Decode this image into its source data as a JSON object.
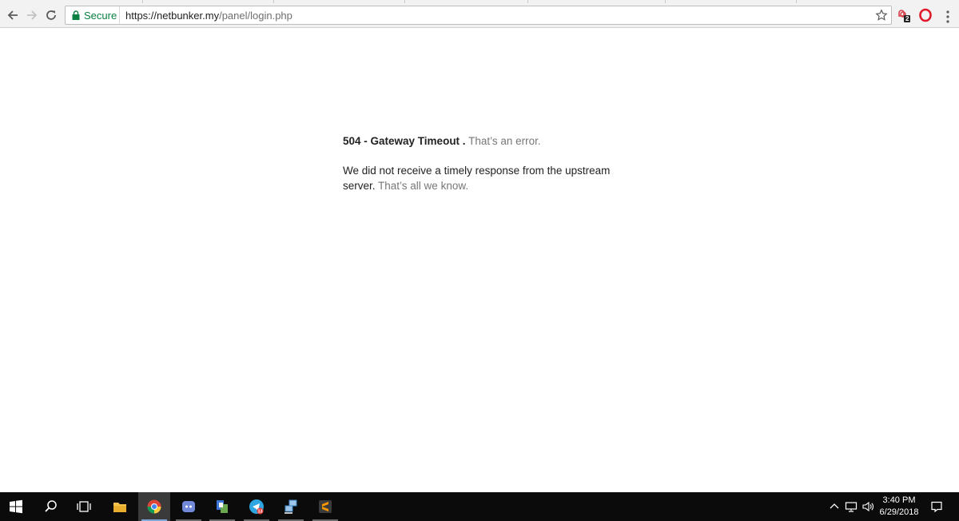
{
  "browser": {
    "omnibox": {
      "secure_label": "Secure",
      "url_scheme_host": "https://netbunker.my",
      "url_path": "/panel/login.php"
    },
    "toolbar_icons": [
      "back-icon",
      "forward-icon",
      "reload-icon",
      "lock-icon",
      "star-icon",
      "extension-icon",
      "opera-icon",
      "menu-icon"
    ],
    "extension_badge": "2",
    "colors": {
      "secure_green": "#0b8043",
      "toolbar_bg": "#f2f2f2",
      "opera_red": "#e0192b"
    }
  },
  "page": {
    "error_code": "504 - Gateway Timeout .",
    "error_suffix": "That’s an error.",
    "message": "We did not receive a timely response from the upstream server.",
    "message_suffix": "That’s all we know.",
    "colors": {
      "text": "#222222",
      "muted": "#777777"
    }
  },
  "taskbar": {
    "apps": [
      "windows-start-icon",
      "search-icon",
      "task-view-icon",
      "file-explorer-icon",
      "chrome-icon",
      "discord-icon",
      "app-icon",
      "telegram-icon",
      "network-app-icon",
      "sublime-text-icon"
    ],
    "telegram_badge": "13",
    "tray_icons": [
      "chevron-up-icon",
      "network-icon",
      "volume-icon",
      "notification-icon"
    ],
    "time": "3:40 PM",
    "date": "6/29/2018",
    "colors": {
      "bg": "#0b0b0b",
      "active_underline": "#7fa7d9"
    }
  }
}
